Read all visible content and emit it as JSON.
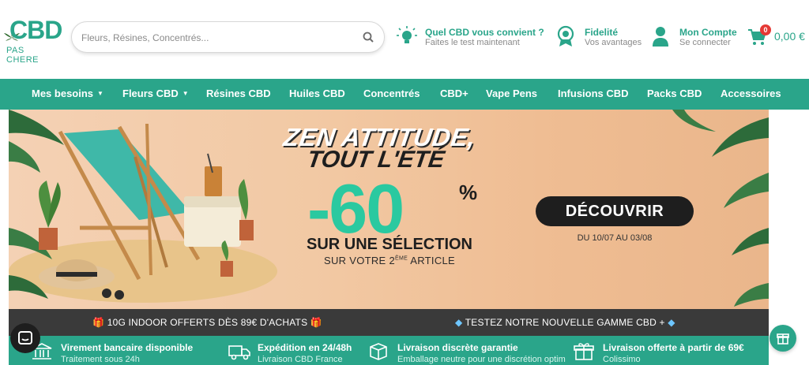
{
  "brand": {
    "logo_main": "CBD",
    "logo_sub": "PAS CHERE",
    "colors": {
      "primary": "#2aa58a",
      "dark": "#1e1e1e",
      "accent_green": "#2ac9a0",
      "badge": "#e53935"
    }
  },
  "search": {
    "placeholder": "Fleurs, Résines, Concentrés..."
  },
  "header_links": [
    {
      "icon": "lightbulb-icon",
      "title": "Quel CBD vous convient ?",
      "subtitle": "Faites le test maintenant"
    },
    {
      "icon": "medal-icon",
      "title": "Fidelité",
      "subtitle": "Vos avantages"
    },
    {
      "icon": "user-icon",
      "title": "Mon Compte",
      "subtitle": "Se connecter"
    }
  ],
  "cart": {
    "count": "0",
    "total": "0,00 €"
  },
  "nav": [
    {
      "label": "Mes besoins",
      "dropdown": true
    },
    {
      "label": "Fleurs CBD",
      "dropdown": true
    },
    {
      "label": "Résines CBD",
      "dropdown": false
    },
    {
      "label": "Huiles CBD",
      "dropdown": false
    },
    {
      "label": "Concentrés",
      "dropdown": false
    },
    {
      "label": "CBD+",
      "dropdown": false
    },
    {
      "label": "Vape Pens",
      "dropdown": false
    },
    {
      "label": "Infusions CBD",
      "dropdown": false
    },
    {
      "label": "Packs CBD",
      "dropdown": false
    },
    {
      "label": "Accessoires",
      "dropdown": false
    }
  ],
  "banner": {
    "headline_line1": "ZEN ATTITUDE,",
    "headline_line2": "TOUT L'ÉTÉ",
    "discount": "-60",
    "discount_unit": "%",
    "line1": "SUR UNE SÉLECTION",
    "line2_prefix": "SUR VOTRE 2",
    "line2_sup": "ÈME",
    "line2_suffix": " ARTICLE",
    "cta": "DÉCOUVRIR",
    "dates": "DU 10/07 AU 03/08"
  },
  "announcements": [
    {
      "text": "10G INDOOR OFFERTS DÈS 89€ D'ACHATS",
      "icon": "gift-icon"
    },
    {
      "text": "TESTEZ NOTRE NOUVELLE GAMME CBD +",
      "icon": "diamond-icon"
    }
  ],
  "features": [
    {
      "icon": "bank-icon",
      "title": "Virement bancaire disponible",
      "subtitle": "Traitement sous 24h"
    },
    {
      "icon": "delivery-truck-icon",
      "title": "Expédition en 24/48h",
      "subtitle": "Livraison CBD France"
    },
    {
      "icon": "package-icon",
      "title": "Livraison discrète garantie",
      "subtitle": "Emballage neutre pour une discrétion optim"
    },
    {
      "icon": "gift-box-icon",
      "title": "Livraison offerte à partir de 69€",
      "subtitle": "Colissimo"
    }
  ]
}
